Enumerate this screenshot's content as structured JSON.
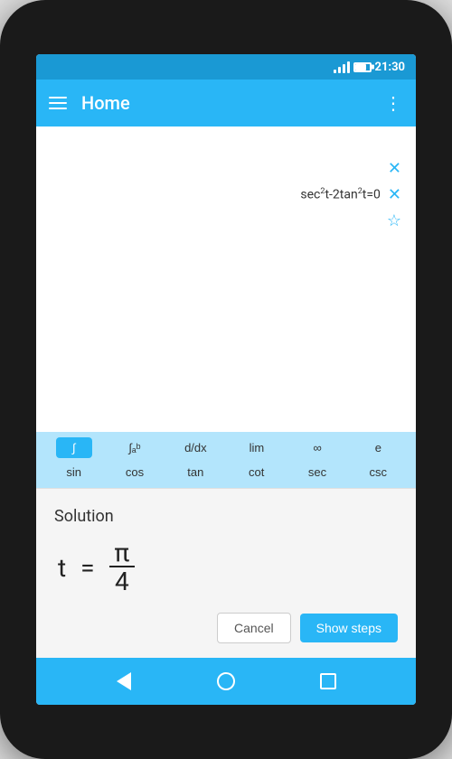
{
  "statusBar": {
    "time": "21:30"
  },
  "appBar": {
    "title": "Home",
    "moreLabel": "⋮"
  },
  "equationArea": {
    "equation": "sec²t-2tan²t=0"
  },
  "keyboard": {
    "row1": [
      {
        "label": "∫",
        "active": true
      },
      {
        "label": "∫ₐᵇ",
        "active": false
      },
      {
        "label": "d/dx",
        "active": false
      },
      {
        "label": "lim",
        "active": false
      },
      {
        "label": "∞",
        "active": false
      },
      {
        "label": "e",
        "active": false
      }
    ],
    "row2": [
      {
        "label": "sin",
        "active": false
      },
      {
        "label": "cos",
        "active": false
      },
      {
        "label": "tan",
        "active": false
      },
      {
        "label": "cot",
        "active": false
      },
      {
        "label": "sec",
        "active": false
      },
      {
        "label": "csc",
        "active": false
      }
    ]
  },
  "solution": {
    "label": "Solution",
    "variable": "t",
    "equals": "=",
    "numerator": "π",
    "denominator": "4"
  },
  "actions": {
    "cancel": "Cancel",
    "showSteps": "Show steps"
  },
  "navBar": {
    "back": "back",
    "home": "home",
    "recent": "recent"
  }
}
